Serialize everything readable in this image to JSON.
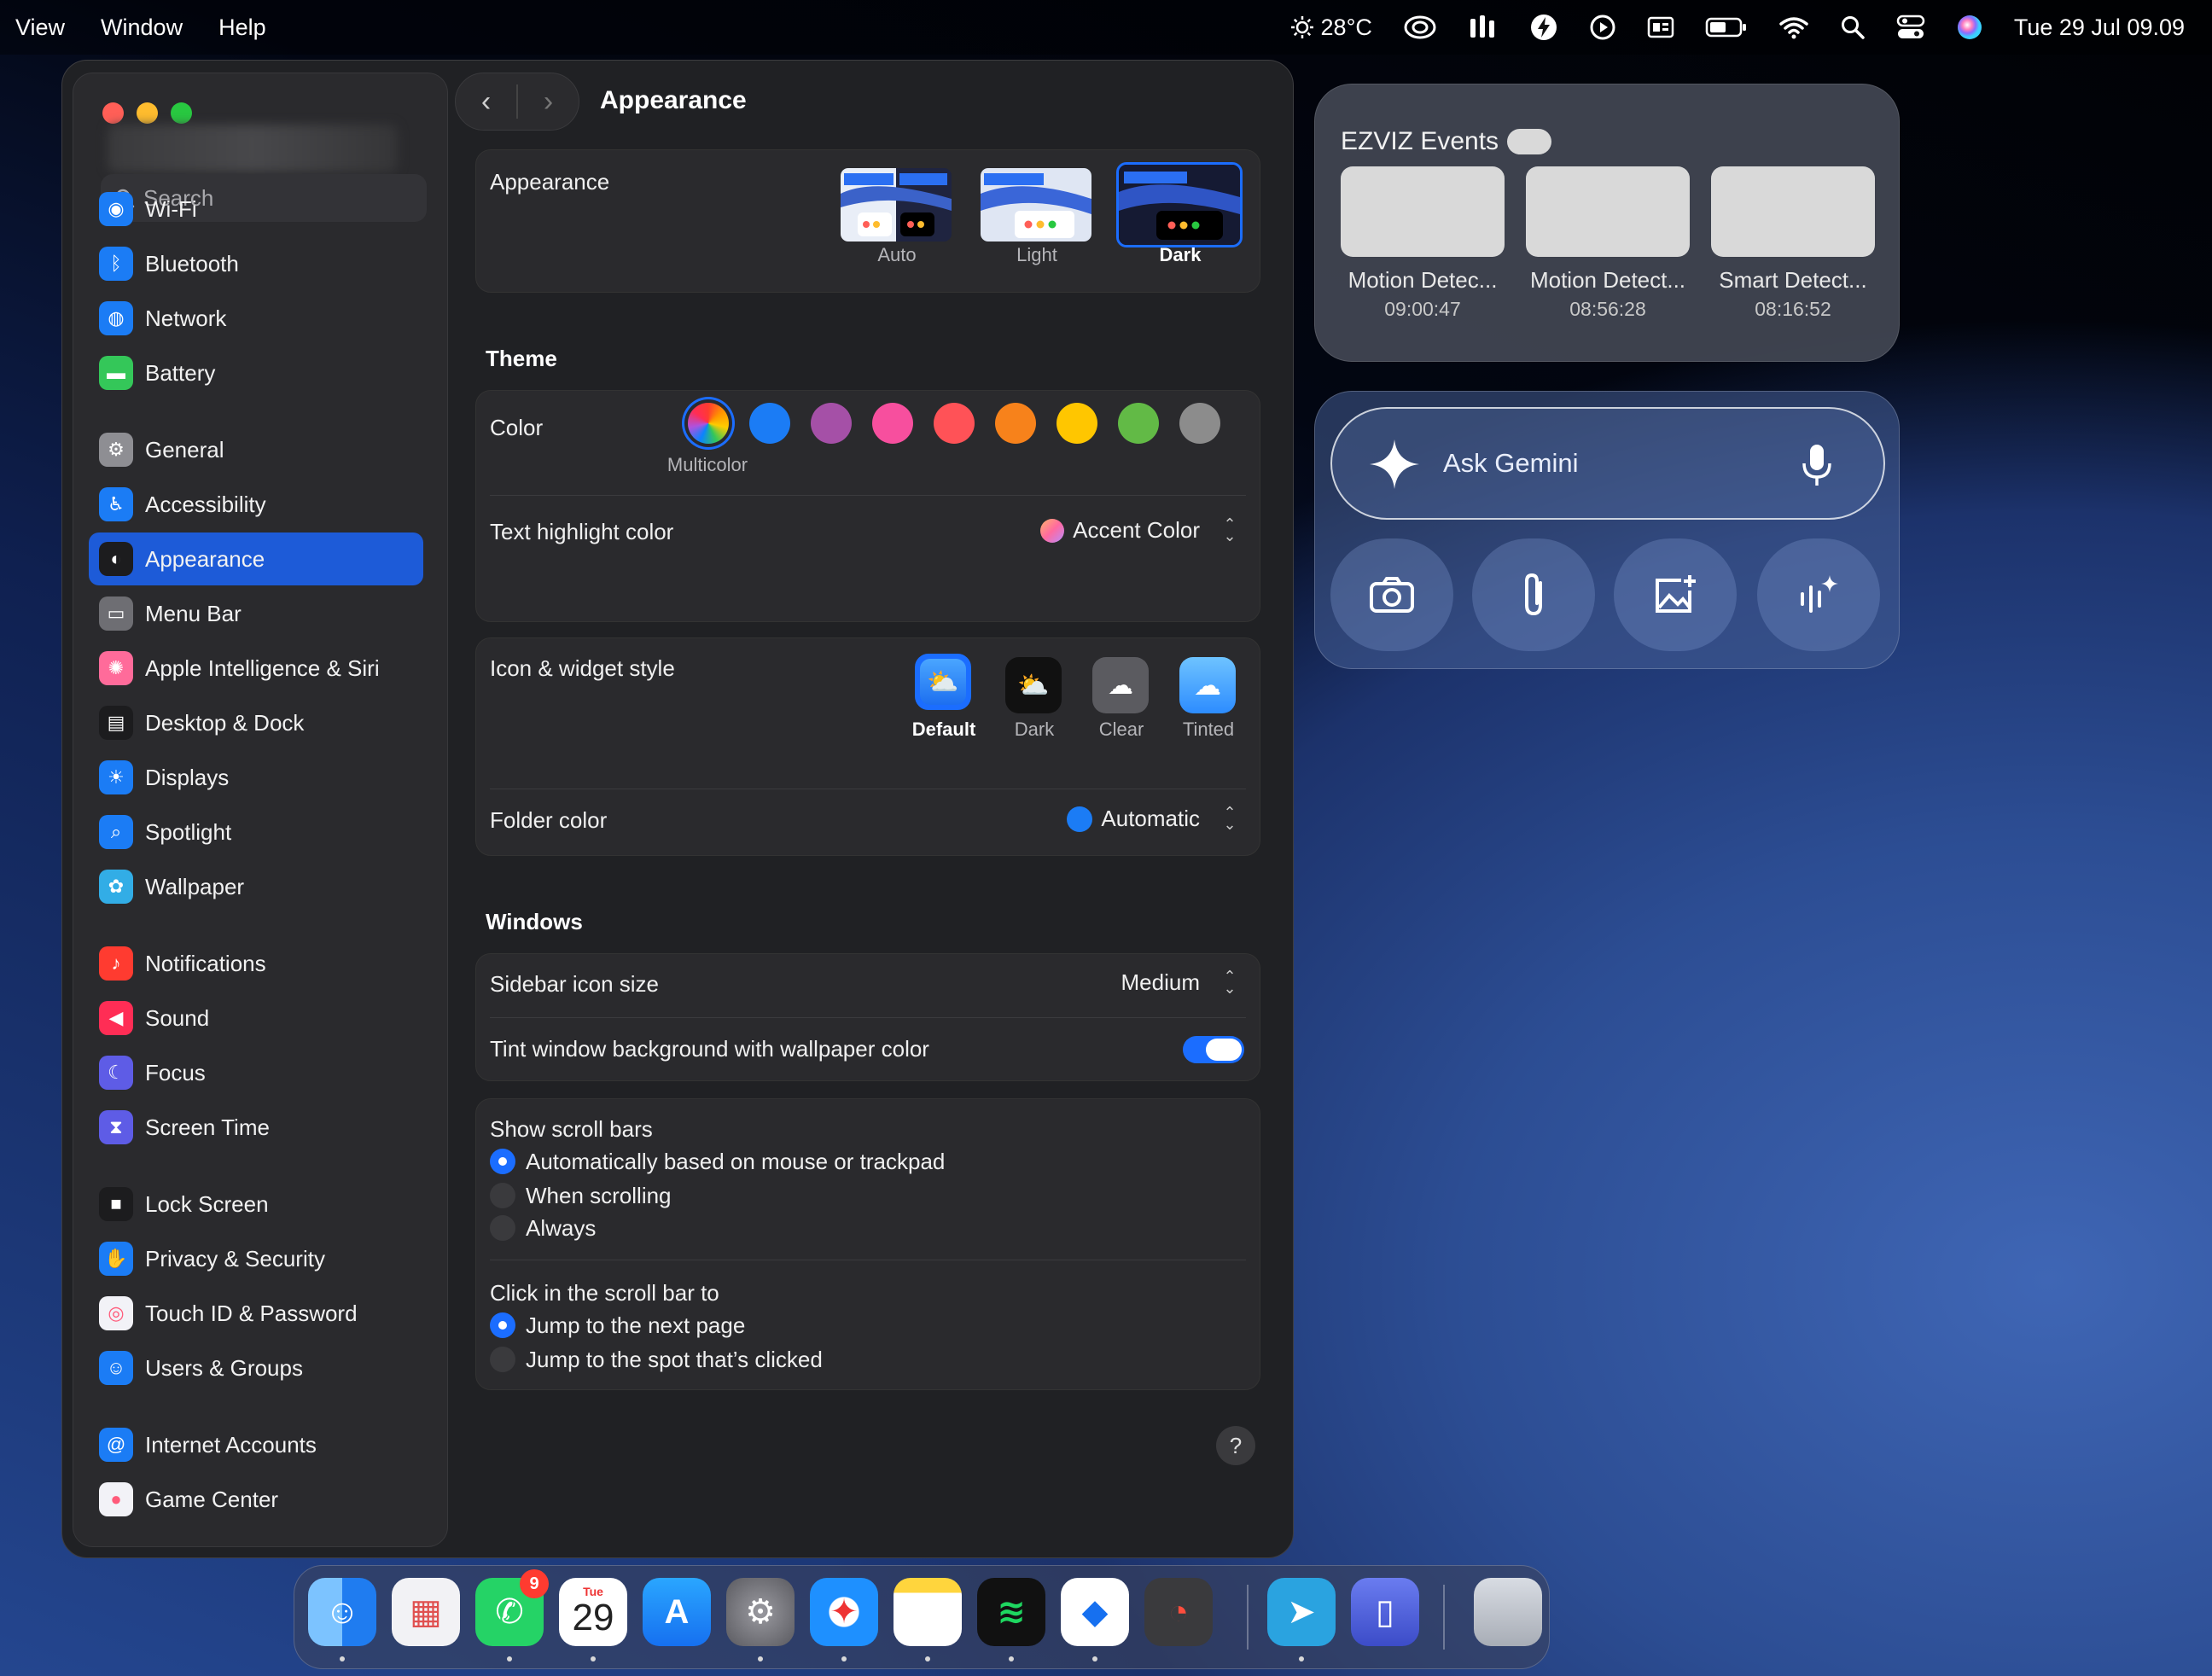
{
  "menubar": {
    "items": [
      "View",
      "Window",
      "Help"
    ],
    "temperature": "28°C",
    "datetime": "Tue 29 Jul 09.09"
  },
  "window": {
    "title": "Appearance"
  },
  "sidebar": {
    "search_placeholder": "Search",
    "items": [
      {
        "label": "Wi-Fi",
        "icon": "wifi-icon",
        "color": "#1b7cf5"
      },
      {
        "label": "Bluetooth",
        "icon": "bluetooth-icon",
        "color": "#1b7cf5"
      },
      {
        "label": "Network",
        "icon": "globe-icon",
        "color": "#1b7cf5"
      },
      {
        "label": "Battery",
        "icon": "battery-icon",
        "color": "#34c759"
      },
      {
        "label": "General",
        "icon": "gear-icon",
        "color": "#8e8e93"
      },
      {
        "label": "Accessibility",
        "icon": "accessibility-icon",
        "color": "#1b7cf5"
      },
      {
        "label": "Appearance",
        "icon": "appearance-icon",
        "color": "#1c1c1e"
      },
      {
        "label": "Menu Bar",
        "icon": "menu-bar-icon",
        "color": "#6e6e73"
      },
      {
        "label": "Apple Intelligence & Siri",
        "icon": "siri-icon",
        "color": "#ff6b9a"
      },
      {
        "label": "Desktop & Dock",
        "icon": "dock-icon",
        "color": "#1c1c1e"
      },
      {
        "label": "Displays",
        "icon": "displays-icon",
        "color": "#1b7cf5"
      },
      {
        "label": "Spotlight",
        "icon": "spotlight-icon",
        "color": "#1b7cf5"
      },
      {
        "label": "Wallpaper",
        "icon": "wallpaper-icon",
        "color": "#32ade6"
      },
      {
        "label": "Notifications",
        "icon": "bell-icon",
        "color": "#ff3b30"
      },
      {
        "label": "Sound",
        "icon": "speaker-icon",
        "color": "#ff2d55"
      },
      {
        "label": "Focus",
        "icon": "moon-icon",
        "color": "#5e5ce6"
      },
      {
        "label": "Screen Time",
        "icon": "hourglass-icon",
        "color": "#5e5ce6"
      },
      {
        "label": "Lock Screen",
        "icon": "lock-icon",
        "color": "#1c1c1e"
      },
      {
        "label": "Privacy & Security",
        "icon": "hand-icon",
        "color": "#1b7cf5"
      },
      {
        "label": "Touch ID & Password",
        "icon": "fingerprint-icon",
        "color": "#f2f2f7"
      },
      {
        "label": "Users & Groups",
        "icon": "users-icon",
        "color": "#1b7cf5"
      },
      {
        "label": "Internet Accounts",
        "icon": "at-icon",
        "color": "#1b7cf5"
      },
      {
        "label": "Game Center",
        "icon": "game-center-icon",
        "color": "#f2f2f7"
      }
    ],
    "selected": "Appearance"
  },
  "appearance": {
    "label": "Appearance",
    "options": [
      {
        "label": "Auto"
      },
      {
        "label": "Light"
      },
      {
        "label": "Dark"
      }
    ],
    "selected": "Dark"
  },
  "theme": {
    "heading": "Theme",
    "color_label": "Color",
    "colors": [
      "multicolor",
      "#1b7cf5",
      "#a550a7",
      "#f74f9e",
      "#ff5257",
      "#f7821b",
      "#ffc600",
      "#62ba46",
      "#8c8c8c"
    ],
    "selected_color_name": "Multicolor",
    "text_highlight_label": "Text highlight color",
    "text_highlight_value": "Accent Color",
    "icon_style_label": "Icon & widget style",
    "icon_styles": [
      {
        "label": "Default"
      },
      {
        "label": "Dark"
      },
      {
        "label": "Clear"
      },
      {
        "label": "Tinted"
      }
    ],
    "icon_style_selected": "Default",
    "folder_color_label": "Folder color",
    "folder_color_value": "Automatic"
  },
  "windows": {
    "heading": "Windows",
    "sidebar_icon_size_label": "Sidebar icon size",
    "sidebar_icon_size_value": "Medium",
    "tint_label": "Tint window background with wallpaper color",
    "tint_on": true,
    "scroll_bars_label": "Show scroll bars",
    "scroll_bars_options": [
      "Automatically based on mouse or trackpad",
      "When scrolling",
      "Always"
    ],
    "scroll_bars_selected": 0,
    "click_label": "Click in the scroll bar to",
    "click_options": [
      "Jump to the next page",
      "Jump to the spot that’s clicked"
    ],
    "click_selected": 0,
    "help": "?"
  },
  "ezviz": {
    "title": "EZVIZ Events",
    "events": [
      {
        "label": "Motion Detec...",
        "time": "09:00:47"
      },
      {
        "label": "Motion Detect...",
        "time": "08:56:28"
      },
      {
        "label": "Smart Detect...",
        "time": "08:16:52"
      }
    ]
  },
  "gemini": {
    "placeholder": "Ask Gemini"
  },
  "dock": {
    "apps": [
      "Finder",
      "Launchpad",
      "WhatsApp",
      "Calendar",
      "App Store",
      "System Settings",
      "Safari",
      "Notes",
      "Spotify",
      "Copilot",
      "Screen Recorder",
      "Telegram",
      "Simulator",
      "Trash"
    ],
    "whatsapp_badge": "9",
    "calendar_month": "Tue",
    "calendar_day": "29"
  }
}
